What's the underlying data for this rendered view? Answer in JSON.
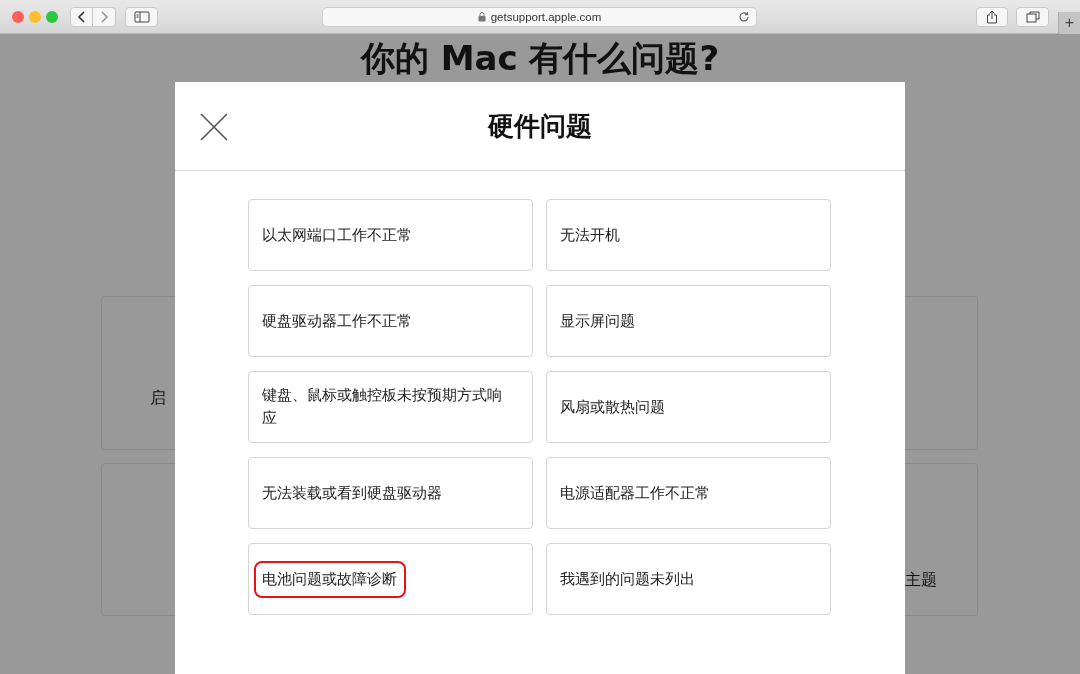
{
  "browser": {
    "address": "getsupport.apple.com",
    "new_tab": "+"
  },
  "page": {
    "title": "你的 Mac 有什么问题?",
    "cards": [
      {
        "text": "启"
      },
      {
        "text": "主题"
      }
    ]
  },
  "dialog": {
    "title": "硬件问题",
    "options": [
      {
        "label": "以太网端口工作不正常",
        "highlighted": false
      },
      {
        "label": "无法开机",
        "highlighted": false
      },
      {
        "label": "硬盘驱动器工作不正常",
        "highlighted": false
      },
      {
        "label": "显示屏问题",
        "highlighted": false
      },
      {
        "label": "键盘、鼠标或触控板未按预期方式响应",
        "highlighted": false
      },
      {
        "label": "风扇或散热问题",
        "highlighted": false
      },
      {
        "label": "无法装载或看到硬盘驱动器",
        "highlighted": false
      },
      {
        "label": "电源适配器工作不正常",
        "highlighted": false
      },
      {
        "label": "电池问题或故障诊断",
        "highlighted": true
      },
      {
        "label": "我遇到的问题未列出",
        "highlighted": false
      }
    ]
  }
}
